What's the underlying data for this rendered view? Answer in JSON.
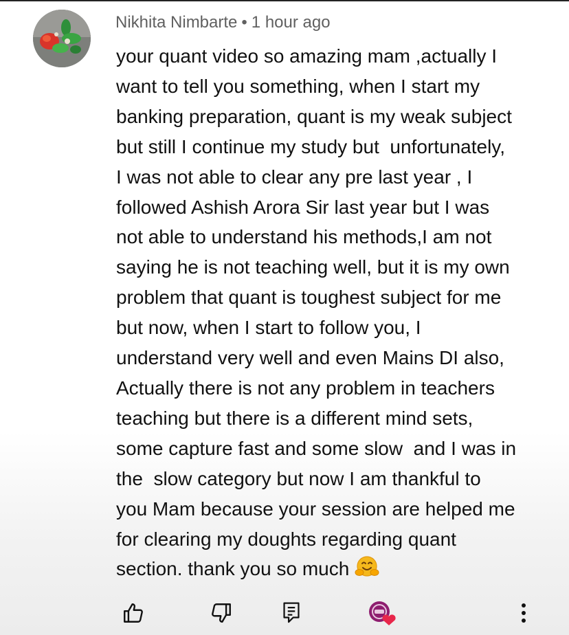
{
  "comment": {
    "author": "Nikhita Nimbarte",
    "separator": "•",
    "timestamp": "1 hour ago",
    "lines": [
      "your quant video so amazing mam ,actually I",
      "want to tell you something, when I start my",
      "banking preparation, quant is my weak subject",
      "but still I continue my study but  unfortunately,",
      "I was not able to clear any pre last year , I",
      "followed Ashish Arora Sir last year but I was",
      "not able to understand his methods,I am not",
      "saying he is not teaching well, but it is my own",
      "problem that quant is toughest subject for me",
      "but now, when I start to follow you, I",
      "understand very well and even Mains DI also,",
      "Actually there is not any problem in teachers",
      "teaching but there is a different mind sets,",
      "some capture fast and some slow  and I was in",
      "the  slow category but now I am thankful to",
      "you Mam because your session are helped me",
      "for clearing my doughts regarding quant",
      "section. thank you so much"
    ],
    "emoji_icon": "hugging-face-emoji"
  },
  "actions": {
    "like_icon": "thumbs-up-icon",
    "dislike_icon": "thumbs-down-icon",
    "reply_icon": "comment-reply-icon",
    "heart_icon": "creator-heart-icon",
    "menu_icon": "more-vertical-icon"
  },
  "colors": {
    "text": "#111111",
    "meta": "#606060",
    "heart": "#e8264a",
    "creator_avatar": "#8e1d6f"
  }
}
